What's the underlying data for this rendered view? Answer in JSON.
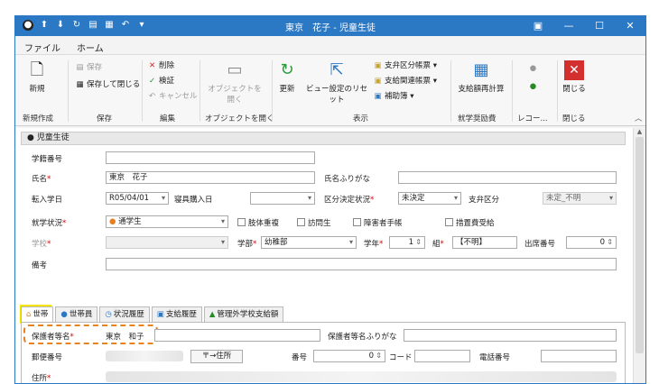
{
  "titlebar": {
    "title": "東京　花子 - 児童生徒"
  },
  "menu": {
    "file": "ファイル",
    "home": "ホーム"
  },
  "ribbon": {
    "new": "新規",
    "save": "保存",
    "save_close": "保存して閉じる",
    "delete": "削除",
    "verify": "検証",
    "cancel": "キャンセル",
    "open_object": "オブジェクトを開く",
    "refresh": "更新",
    "view_reset": "ビュー設定のリセット",
    "payment_class_ledger": "支弁区分帳票",
    "payment_related_ledger": "支給関連帳票",
    "supplement_book": "補助簿",
    "recalc": "支給額再計算",
    "close": "閉じる",
    "groups": {
      "new_create": "新規作成",
      "save": "保存",
      "edit": "編集",
      "open_object": "オブジェクトを開く",
      "display": "表示",
      "scholarship": "就学奨励費",
      "record": "レコー...",
      "close": "閉じる"
    }
  },
  "panel": {
    "title": "児童生徒"
  },
  "form": {
    "student_no_label": "学籍番号",
    "name_label": "氏名",
    "name_value": "東京　花子",
    "name_kana_label": "氏名ふりがな",
    "transfer_date_label": "転入学日",
    "transfer_date_value": "R05/04/01",
    "bedding_date_label": "寝具購入日",
    "decision_status_label": "区分決定状況",
    "decision_status_value": "未決定",
    "payment_class_label": "支弁区分",
    "payment_class_value": "未定_不明",
    "enroll_status_label": "就学状況",
    "enroll_status_value": "通学生",
    "check_multi": "肢体重複",
    "check_visit": "訪問生",
    "check_handbook": "障害者手帳",
    "check_measure": "措置費受給",
    "school_label": "学校",
    "dept_label": "学部",
    "dept_value": "幼稚部",
    "grade_label": "学年",
    "grade_value": "1",
    "class_label": "組",
    "class_value": "【不明】",
    "attendance_label": "出席番号",
    "attendance_value": "0",
    "remarks_label": "備考"
  },
  "tabs": [
    "世帯",
    "世帯員",
    "状況履歴",
    "支給履歴",
    "管理外学校支給額"
  ],
  "household": {
    "guardian_label": "保護者等名",
    "guardian_value": "東京　和子",
    "guardian_kana_label": "保護者等名ふりがな",
    "postal_label": "郵便番号",
    "address_button": "〒→住所",
    "number_label": "番号",
    "number_value": "0",
    "code_label": "コード",
    "phone_label": "電話番号",
    "address_label": "住所"
  }
}
